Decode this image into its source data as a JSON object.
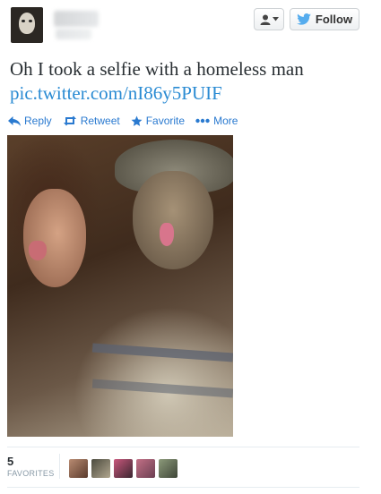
{
  "header": {
    "follow_label": "Follow",
    "user_menu_icon": "user-dropdown-icon",
    "brand_icon": "twitter-bird-icon"
  },
  "tweet": {
    "text": "Oh I took a selfie with a homeless man",
    "link": "pic.twitter.com/nI86y5PUIF"
  },
  "actions": {
    "reply": "Reply",
    "retweet": "Retweet",
    "favorite": "Favorite",
    "more": "More"
  },
  "stats": {
    "favorites_count": "5",
    "favorites_label": "FAVORITES"
  },
  "colors": {
    "link": "#2a8bd3",
    "action": "#2a7ad0",
    "text": "#292f33",
    "muted": "#8899a6"
  },
  "favoriters": [
    {
      "color_a": "#b98c72",
      "color_b": "#5a3a2c"
    },
    {
      "color_a": "#4b4a3e",
      "color_b": "#b0a68e"
    },
    {
      "color_a": "#c9577c",
      "color_b": "#3a2630"
    },
    {
      "color_a": "#c26f85",
      "color_b": "#6b3f52"
    },
    {
      "color_a": "#8c9a7a",
      "color_b": "#3f4638"
    }
  ]
}
